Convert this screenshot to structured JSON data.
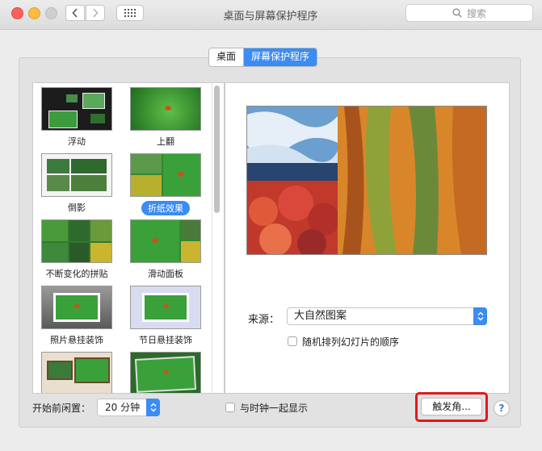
{
  "window": {
    "title": "桌面与屏幕保护程序"
  },
  "toolbar": {
    "back_icon": "chevron-left-icon",
    "forward_icon": "chevron-right-icon",
    "show_all_icon": "grid-icon",
    "search_placeholder": "搜索",
    "search_icon": "search-icon"
  },
  "tabs": [
    {
      "label": "桌面",
      "active": false
    },
    {
      "label": "屏幕保护程序",
      "active": true
    }
  ],
  "savers": [
    {
      "label": "浮动",
      "selected": false
    },
    {
      "label": "上翻",
      "selected": false
    },
    {
      "label": "倒影",
      "selected": false
    },
    {
      "label": "折纸效果",
      "selected": true
    },
    {
      "label": "不断变化的拼贴",
      "selected": false
    },
    {
      "label": "滑动面板",
      "selected": false
    },
    {
      "label": "照片悬挂装饰",
      "selected": false
    },
    {
      "label": "节日悬挂装饰",
      "selected": false
    }
  ],
  "options": {
    "source_label": "来源：",
    "source_value": "大自然图案",
    "shuffle_label": "随机排列幻灯片的顺序",
    "shuffle_checked": false
  },
  "bottom": {
    "start_label": "开始前闲置：",
    "idle_value": "20 分钟",
    "show_clock_label": "与时钟一起显示",
    "show_clock_checked": false,
    "hot_corners_label": "触发角...",
    "help_label": "?"
  },
  "colors": {
    "accent": "#3b8cf3",
    "highlight_box": "#e0191b"
  }
}
